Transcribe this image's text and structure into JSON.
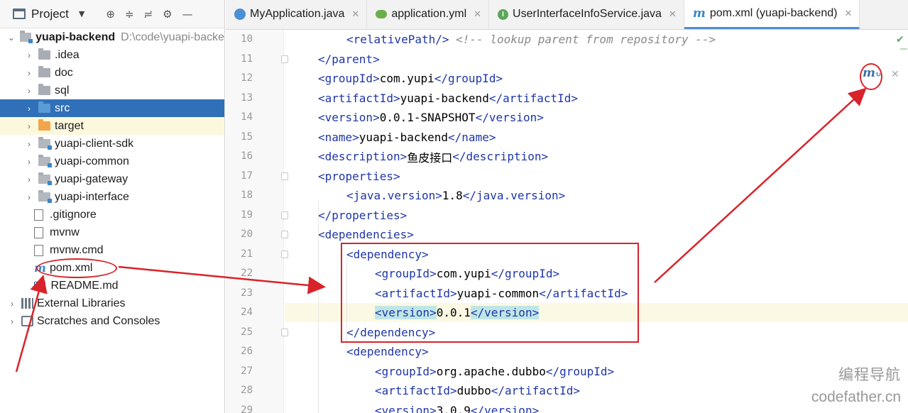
{
  "project_panel": {
    "title": "Project",
    "dropdown_icon": "chevron-down-icon",
    "tools": [
      "locate-icon",
      "expand-all-icon",
      "collapse-all-icon",
      "gear-icon",
      "hide-icon"
    ],
    "tree": [
      {
        "label": "yuapi-backend",
        "path": "D:\\code\\yuapi-backe",
        "kind": "root",
        "expanded": true
      },
      {
        "label": ".idea",
        "kind": "folder"
      },
      {
        "label": "doc",
        "kind": "folder"
      },
      {
        "label": "sql",
        "kind": "folder"
      },
      {
        "label": "src",
        "kind": "folder-blue",
        "selected": true
      },
      {
        "label": "target",
        "kind": "folder-orange",
        "highlighted": true
      },
      {
        "label": "yuapi-client-sdk",
        "kind": "module"
      },
      {
        "label": "yuapi-common",
        "kind": "module"
      },
      {
        "label": "yuapi-gateway",
        "kind": "module"
      },
      {
        "label": "yuapi-interface",
        "kind": "module"
      },
      {
        "label": ".gitignore",
        "kind": "file"
      },
      {
        "label": "mvnw",
        "kind": "file"
      },
      {
        "label": "mvnw.cmd",
        "kind": "file"
      },
      {
        "label": "pom.xml",
        "kind": "maven"
      },
      {
        "label": "README.md",
        "kind": "md"
      },
      {
        "label": "External Libraries",
        "kind": "libraries"
      },
      {
        "label": "Scratches and Consoles",
        "kind": "scratches"
      }
    ]
  },
  "tabs": [
    {
      "label": "MyApplication.java",
      "icon": "java-class-icon",
      "active": false
    },
    {
      "label": "application.yml",
      "icon": "yml-config-icon",
      "active": false
    },
    {
      "label": "UserInterfaceInfoService.java",
      "icon": "interface-icon",
      "active": false
    },
    {
      "label": "pom.xml (yuapi-backend)",
      "icon": "maven-icon",
      "active": true
    }
  ],
  "editor": {
    "lines": [
      {
        "no": "10",
        "indent": 1,
        "parts": [
          [
            "tag",
            "<relativePath/>"
          ],
          [
            "txt",
            " "
          ],
          [
            "cmt",
            "<!-- lookup parent from repository -->"
          ]
        ]
      },
      {
        "no": "11",
        "indent": 0,
        "parts": [
          [
            "tag",
            "</parent>"
          ]
        ]
      },
      {
        "no": "12",
        "indent": 0,
        "parts": [
          [
            "tag",
            "<groupId>"
          ],
          [
            "txt",
            "com.yupi"
          ],
          [
            "tag",
            "</groupId>"
          ]
        ]
      },
      {
        "no": "13",
        "indent": 0,
        "parts": [
          [
            "tag",
            "<artifactId>"
          ],
          [
            "txt",
            "yuapi-backend"
          ],
          [
            "tag",
            "</artifactId>"
          ]
        ]
      },
      {
        "no": "14",
        "indent": 0,
        "parts": [
          [
            "tag",
            "<version>"
          ],
          [
            "txt",
            "0.0.1-SNAPSHOT"
          ],
          [
            "tag",
            "</version>"
          ]
        ]
      },
      {
        "no": "15",
        "indent": 0,
        "parts": [
          [
            "tag",
            "<name>"
          ],
          [
            "txt",
            "yuapi-backend"
          ],
          [
            "tag",
            "</name>"
          ]
        ]
      },
      {
        "no": "16",
        "indent": 0,
        "parts": [
          [
            "tag",
            "<description>"
          ],
          [
            "cn",
            "鱼皮接口"
          ],
          [
            "tag",
            "</description>"
          ]
        ]
      },
      {
        "no": "17",
        "indent": 0,
        "parts": [
          [
            "tag",
            "<properties>"
          ]
        ]
      },
      {
        "no": "18",
        "indent": 1,
        "parts": [
          [
            "tag",
            "<java.version>"
          ],
          [
            "txt",
            "1.8"
          ],
          [
            "tag",
            "</java.version>"
          ]
        ]
      },
      {
        "no": "19",
        "indent": 0,
        "parts": [
          [
            "tag",
            "</properties>"
          ]
        ]
      },
      {
        "no": "20",
        "indent": 0,
        "parts": [
          [
            "tag",
            "<dependencies>"
          ]
        ]
      },
      {
        "no": "21",
        "indent": 1,
        "parts": [
          [
            "tag",
            "<dependency>"
          ]
        ]
      },
      {
        "no": "22",
        "indent": 2,
        "parts": [
          [
            "tag",
            "<groupId>"
          ],
          [
            "txt",
            "com.yupi"
          ],
          [
            "tag",
            "</groupId>"
          ]
        ]
      },
      {
        "no": "23",
        "indent": 2,
        "parts": [
          [
            "tag",
            "<artifactId>"
          ],
          [
            "txt",
            "yuapi-common"
          ],
          [
            "tag",
            "</artifactId>"
          ]
        ]
      },
      {
        "no": "24",
        "indent": 2,
        "current": true,
        "parts": [
          [
            "match",
            "<version>"
          ],
          [
            "txt",
            "0.0.1"
          ],
          [
            "match",
            "</version>"
          ]
        ]
      },
      {
        "no": "25",
        "indent": 1,
        "parts": [
          [
            "tag",
            "</dependency>"
          ]
        ]
      },
      {
        "no": "26",
        "indent": 1,
        "parts": [
          [
            "tag",
            "<dependency>"
          ]
        ]
      },
      {
        "no": "27",
        "indent": 2,
        "parts": [
          [
            "tag",
            "<groupId>"
          ],
          [
            "txt",
            "org.apache.dubbo"
          ],
          [
            "tag",
            "</groupId>"
          ]
        ]
      },
      {
        "no": "28",
        "indent": 2,
        "parts": [
          [
            "tag",
            "<artifactId>"
          ],
          [
            "txt",
            "dubbo"
          ],
          [
            "tag",
            "</artifactId>"
          ]
        ]
      },
      {
        "no": "29",
        "indent": 2,
        "parts": [
          [
            "tag",
            "<version>"
          ],
          [
            "txt",
            "3.0.9"
          ],
          [
            "tag",
            "</version>"
          ]
        ]
      }
    ]
  },
  "maven_reload": {
    "icon": "maven-reload-icon",
    "close_icon": "close-icon"
  },
  "status": {
    "check_icon": "check-icon"
  },
  "watermark": {
    "line1": "编程导航",
    "line2": "codefather.cn"
  },
  "colors": {
    "tag": "#1f36a8",
    "comment": "#8a8a8a",
    "selection": "#2f70b9",
    "annotation": "#d8232a",
    "match": "#bfe6e6"
  }
}
